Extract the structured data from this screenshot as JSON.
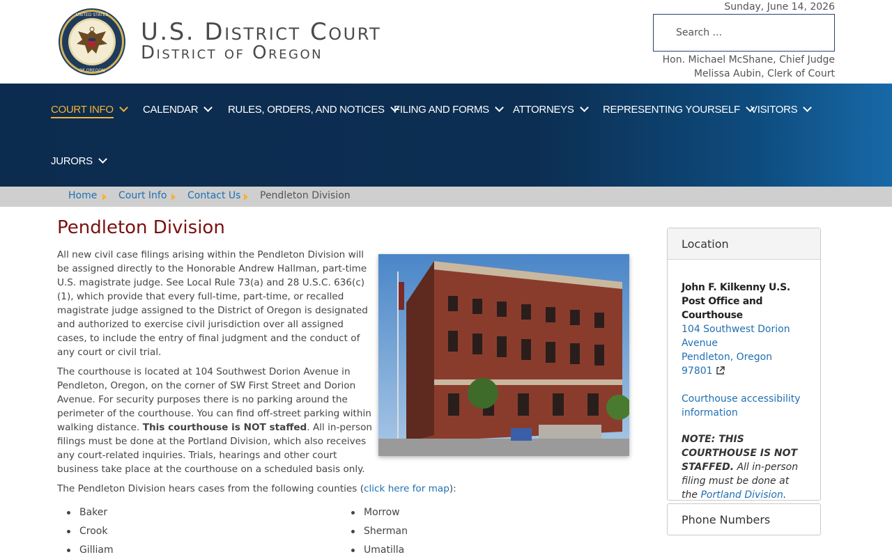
{
  "header": {
    "title_line1": "U.S. District Court",
    "title_line2": "District of Oregon",
    "date": "Sunday, June 14, 2026",
    "search_placeholder": "Search ...",
    "chief_judge": "Hon. Michael McShane, Chief Judge",
    "clerk": "Melissa Aubin, Clerk of Court",
    "seal_text": "UNITED STATES DISTRICT COURT DISTRICT OF OREGON"
  },
  "nav": {
    "items": [
      {
        "label": "COURT INFO",
        "active": true
      },
      {
        "label": "CALENDAR"
      },
      {
        "label": "RULES, ORDERS, AND NOTICES"
      },
      {
        "label": "FILING AND FORMS"
      },
      {
        "label": "ATTORNEYS"
      },
      {
        "label": "REPRESENTING YOURSELF"
      },
      {
        "label": "VISITORS"
      },
      {
        "label": "JURORS"
      }
    ]
  },
  "breadcrumb": {
    "items": [
      "Home",
      "Court Info",
      "Contact Us"
    ],
    "current": "Pendleton Division"
  },
  "main": {
    "title": "Pendleton Division",
    "paragraph1": "All new civil case filings arising within the Pendleton Division will be assigned directly to the Honorable Andrew Hallman, part-time U.S. magistrate judge. See Local Rule 73(a) and 28 U.S.C. 636(c)(1), which provide that every full-time, part-time, or recalled magistrate judge assigned to the District of Oregon is designated and authorized to exercise civil jurisdiction over all assigned cases, to include the entry of final judgment and the conduct of any court or civil trial.",
    "paragraph2_a": "The courthouse is located at 104 Southwest Dorion Avenue in Pendleton, Oregon, on the corner of SW First Street and Dorion Avenue. For security purposes there is no parking around the perimeter of the courthouse. You can find off-street parking within walking distance. ",
    "paragraph2_bold": "This courthouse is NOT staffed",
    "paragraph2_b": ". All in-person filings must be done at the Portland Division, which also receives any court-related inquiries. Trials, hearings and other court business take place at the courthouse on a scheduled basis only.",
    "paragraph3_a": "The Pendleton Division hears cases from the following counties (",
    "paragraph3_link": "click here for map",
    "paragraph3_b": "):",
    "counties_col1": [
      "Baker",
      "Crook",
      "Gilliam"
    ],
    "counties_col2": [
      "Morrow",
      "Sherman",
      "Umatilla"
    ]
  },
  "sidebar": {
    "location_title": "Location",
    "building": "John F. Kilkenny U.S. Post Office and Courthouse",
    "address1": "104 Southwest Dorion Avenue",
    "address2": "Pendleton, Oregon",
    "zip": "97801",
    "accessibility_link": "Courthouse accessibility information",
    "note_bold": "NOTE: THIS COURTHOUSE IS NOT STAFFED.",
    "note_text": " All in-person filing must be done at the ",
    "note_link": "Portland Division",
    "note_end": ".",
    "phone_title": "Phone Numbers"
  },
  "colors": {
    "nav_dark": "#0c2c4f",
    "nav_light": "#1869a8",
    "accent": "#f5b335",
    "title_red": "#7a1010",
    "link": "#1f6fb2"
  }
}
